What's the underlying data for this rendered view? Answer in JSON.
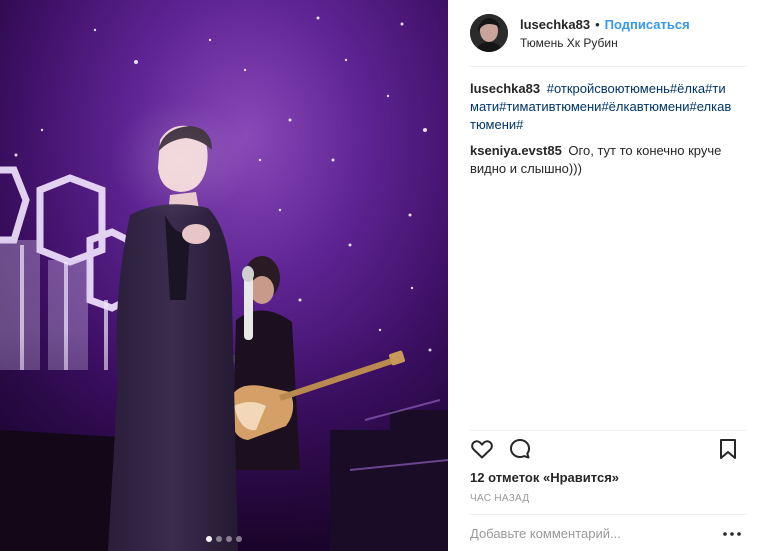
{
  "media": {
    "description_icon": "concert-photo",
    "carousel": {
      "total": 4,
      "active_index": 0
    }
  },
  "header": {
    "username": "lusechka83",
    "separator": "•",
    "follow_label": "Подписаться",
    "location": "Тюмень Хк Рубин"
  },
  "comments": [
    {
      "user": "lusechka83",
      "hashtags": [
        "#откройсвоютюмень",
        "#ёлка",
        "#тимати",
        "#тимативтюмени",
        "#ёлкавтюмени",
        "#елкавтюмени",
        "#"
      ]
    },
    {
      "user": "kseniya.evst85",
      "text": "Ого, тут то конечно круче видно и слышно)))"
    }
  ],
  "actions": {
    "icons": [
      "heart-icon",
      "comment-icon",
      "bookmark-icon"
    ],
    "likes_count": "12 отметок",
    "likes_suffix": "«Нравится»",
    "time": "ЧАС НАЗАД"
  },
  "add_comment": {
    "placeholder": "Добавьте комментарий...",
    "more_icon": "more-options-icon"
  },
  "colors": {
    "link": "#3897f0",
    "hashtag": "#003569",
    "border": "#efefef",
    "muted": "#999999",
    "stage_purple": "#5b1a86"
  }
}
